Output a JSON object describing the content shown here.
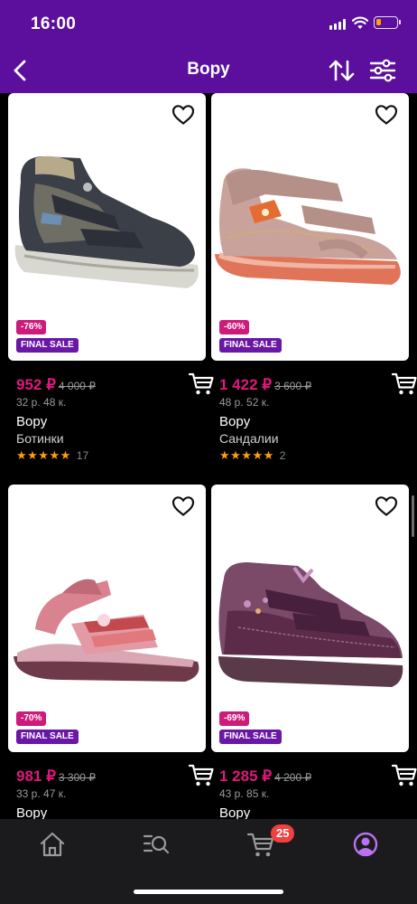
{
  "status_bar": {
    "time": "16:00"
  },
  "nav": {
    "title": "Bopy"
  },
  "products": [
    {
      "price": "952 ₽",
      "old_price": "4 000 ₽",
      "installment": "32 р. 48 к.",
      "brand": "Bopy",
      "category": "Ботинки",
      "stars": "★★★★★",
      "reviews": "17",
      "discount": "-76%",
      "final_sale": "FINAL SALE"
    },
    {
      "price": "1 422 ₽",
      "old_price": "3 600 ₽",
      "installment": "48 р. 52 к.",
      "brand": "Bopy",
      "category": "Сандалии",
      "stars": "★★★★★",
      "reviews": "2",
      "discount": "-60%",
      "final_sale": "FINAL SALE"
    },
    {
      "price": "981 ₽",
      "old_price": "3 300 ₽",
      "installment": "33 р. 47 к.",
      "brand": "Bopy",
      "discount": "-70%",
      "final_sale": "FINAL SALE"
    },
    {
      "price": "1 285 ₽",
      "old_price": "4 200 ₽",
      "installment": "43 р. 85 к.",
      "brand": "Bopy",
      "discount": "-69%",
      "final_sale": "FINAL SALE"
    }
  ],
  "tab_bar": {
    "cart_count": "25"
  },
  "colors": {
    "header": "#5b0f9c",
    "price": "#e0187c",
    "discount_badge": "#cd1a7b",
    "final_sale_badge": "#6a17a6",
    "stars": "#ff9f0a",
    "cart_badge": "#f23f3f",
    "active_tab": "#b872f2"
  }
}
